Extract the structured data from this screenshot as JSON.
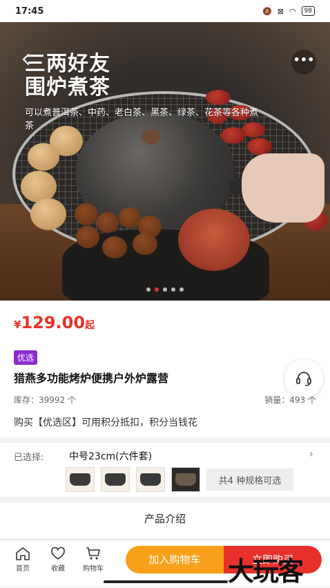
{
  "status": {
    "time": "17:45",
    "battery": "98"
  },
  "hero": {
    "title_line1": "三两好友",
    "title_line2": "围炉煮茶",
    "subtitle": "可以煮普洱茶、中药、老白茶、黑茶、绿茶、花茶等各种煮茶",
    "back_icon": "chevron-left-icon",
    "more_icon": "more-dots-icon",
    "slide_count": 5,
    "active_slide": 1
  },
  "product": {
    "currency": "¥",
    "price": "129.00",
    "price_suffix": "起",
    "tag": "优选",
    "title": "猎燕多功能烤炉便携户外炉露营",
    "stock": "库存：39992 个",
    "sales": "销量：493 个",
    "note": "购买【优选区】可用积分抵扣，积分当钱花",
    "service_icon": "customer-service-icon"
  },
  "spec": {
    "label": "已选择:",
    "value": "中号23cm(六件套)",
    "more": "共4 种规格可选"
  },
  "intro": {
    "title": "产品介绍"
  },
  "bottom": {
    "home": "首页",
    "favorite": "收藏",
    "cart": "购物车",
    "add_to_cart": "加入购物车",
    "buy_now": "立即购买"
  },
  "watermark": "大玩客",
  "colors": {
    "price_red": "#e8312b",
    "tag_purple": "#8b2bd1",
    "cart_orange": "#f7a11a"
  }
}
